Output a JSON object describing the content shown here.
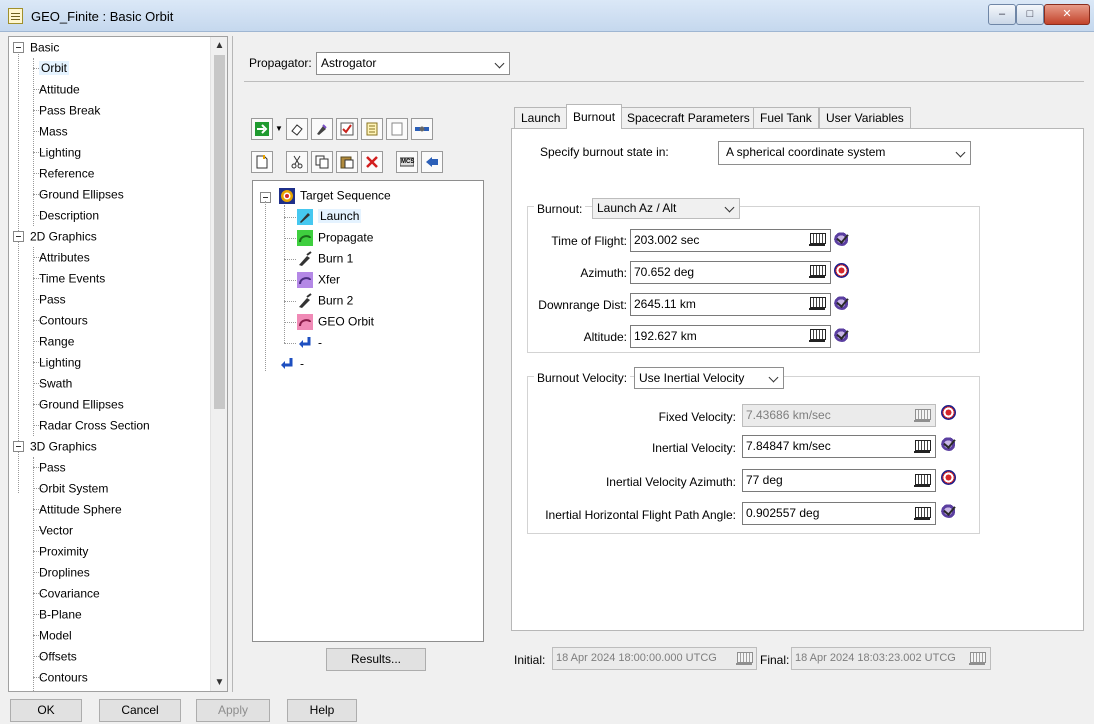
{
  "window": {
    "title": "GEO_Finite : Basic Orbit",
    "controls": {
      "minimize": "–",
      "maximize": "□",
      "close": "✕"
    }
  },
  "left_tree": {
    "groups": [
      {
        "label": "Basic",
        "items": [
          "Orbit",
          "Attitude",
          "Pass Break",
          "Mass",
          "Lighting",
          "Reference",
          "Ground Ellipses",
          "Description"
        ]
      },
      {
        "label": "2D Graphics",
        "items": [
          "Attributes",
          "Time Events",
          "Pass",
          "Contours",
          "Range",
          "Lighting",
          "Swath",
          "Ground Ellipses",
          "Radar Cross Section"
        ]
      },
      {
        "label": "3D Graphics",
        "items": [
          "Pass",
          "Orbit System",
          "Attitude Sphere",
          "Vector",
          "Proximity",
          "Droplines",
          "Covariance",
          "B-Plane",
          "Model",
          "Offsets",
          "Contours"
        ]
      }
    ],
    "selected": "Orbit"
  },
  "propagator": {
    "label": "Propagator:",
    "value": "Astrogator"
  },
  "toolbar": {
    "row1": [
      "run-icon",
      "dropdown-arrow",
      "eraser-icon",
      "paint-icon",
      "checklist-icon",
      "notes-icon",
      "blank-icon",
      "satellite-icon"
    ],
    "row2": [
      "new-icon",
      "cut-icon",
      "copy-icon",
      "paste-icon",
      "delete-icon",
      "mcs-icon",
      "insert-icon"
    ],
    "mcs_label": "MCS"
  },
  "sequence": {
    "root": "Target Sequence",
    "children": [
      "Launch",
      "Propagate",
      "Burn 1",
      "Xfer",
      "Burn 2",
      "GEO Orbit",
      "-"
    ],
    "end": "-",
    "selected": "Launch"
  },
  "results_button": "Results...",
  "tabs": [
    {
      "label": "Launch"
    },
    {
      "label": "Burnout"
    },
    {
      "label": "Spacecraft Parameters"
    },
    {
      "label": "Fuel Tank"
    },
    {
      "label": "User Variables"
    }
  ],
  "active_tab": "Burnout",
  "burnout": {
    "specify_label": "Specify burnout state in:",
    "specify_value": "A spherical coordinate system",
    "burnout_label": "Burnout:",
    "burnout_value": "Launch Az / Alt",
    "fields": [
      {
        "label": "Time of Flight:",
        "value": "203.002 sec",
        "marker": "check"
      },
      {
        "label": "Azimuth:",
        "value": "70.652 deg",
        "marker": "target"
      },
      {
        "label": "Downrange Dist:",
        "value": "2645.11 km",
        "marker": "check"
      },
      {
        "label": "Altitude:",
        "value": "192.627 km",
        "marker": "check"
      }
    ],
    "velocity_label": "Burnout Velocity:",
    "velocity_value": "Use Inertial Velocity",
    "velocity_fields": [
      {
        "label": "Fixed Velocity:",
        "value": "7.43686 km/sec",
        "marker": "target",
        "disabled": true
      },
      {
        "label": "Inertial Velocity:",
        "value": "7.84847 km/sec",
        "marker": "check",
        "disabled": false
      },
      {
        "label": "Inertial Velocity Azimuth:",
        "value": "77 deg",
        "marker": "target",
        "disabled": false
      },
      {
        "label": "Inertial Horizontal Flight Path Angle:",
        "value": "0.902557 deg",
        "marker": "check",
        "disabled": false
      }
    ]
  },
  "epochs": {
    "initial_label": "Initial:",
    "initial_value": "18 Apr 2024 18:00:00.000 UTCG",
    "final_label": "Final:",
    "final_value": "18 Apr 2024 18:03:23.002 UTCG"
  },
  "bottom_buttons": {
    "ok": "OK",
    "cancel": "Cancel",
    "apply": "Apply",
    "help": "Help"
  },
  "colors": {
    "titlebar": "#c5d8ee",
    "selection": "#e5f3ff",
    "target_red": "#d4272a",
    "check_purple": "#5b3fa0"
  }
}
